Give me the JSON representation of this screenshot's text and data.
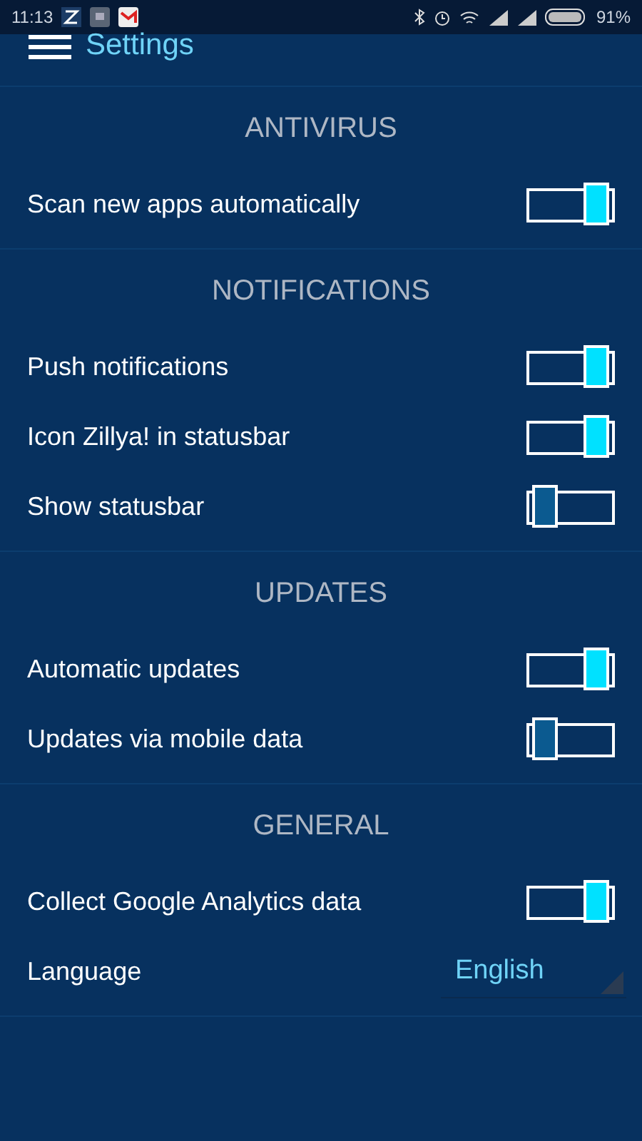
{
  "status_bar": {
    "time": "11:13",
    "battery": "91%"
  },
  "header": {
    "title": "Settings"
  },
  "sections": [
    {
      "title": "ANTIVIRUS",
      "rows": [
        {
          "kind": "toggle",
          "label": "Scan new apps automatically",
          "on": true
        }
      ]
    },
    {
      "title": "NOTIFICATIONS",
      "rows": [
        {
          "kind": "toggle",
          "label": "Push notifications",
          "on": true
        },
        {
          "kind": "toggle",
          "label": "Icon Zillya! in statusbar",
          "on": true
        },
        {
          "kind": "toggle",
          "label": "Show statusbar",
          "on": false
        }
      ]
    },
    {
      "title": "UPDATES",
      "rows": [
        {
          "kind": "toggle",
          "label": "Automatic updates",
          "on": true
        },
        {
          "kind": "toggle",
          "label": "Updates via mobile data",
          "on": false
        }
      ]
    },
    {
      "title": "GENERAL",
      "rows": [
        {
          "kind": "toggle",
          "label": "Collect Google Analytics data",
          "on": true
        },
        {
          "kind": "select",
          "label": "Language",
          "value": "English"
        }
      ]
    }
  ]
}
